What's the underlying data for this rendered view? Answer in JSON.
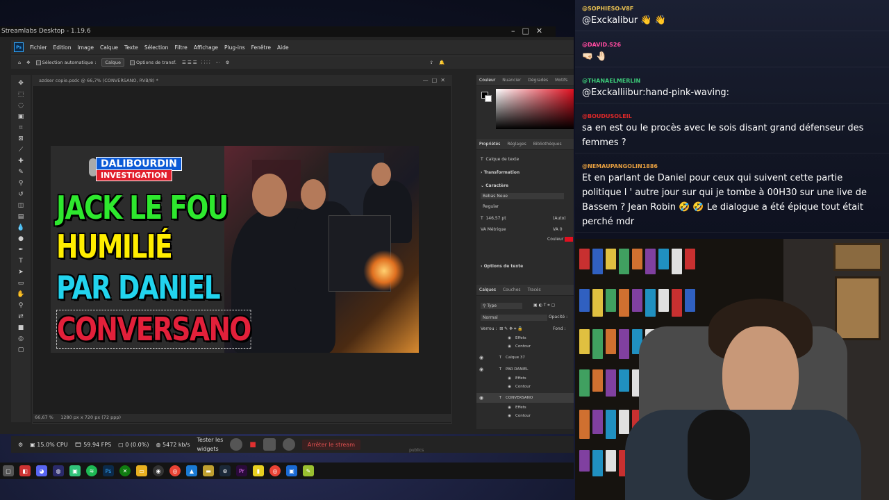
{
  "streamlabs": {
    "title": "Streamlabs Desktop - 1.19.6"
  },
  "photoshop": {
    "logo": "Ps",
    "menu": [
      "Fichier",
      "Edition",
      "Image",
      "Calque",
      "Texte",
      "Sélection",
      "Filtre",
      "Affichage",
      "Plug-ins",
      "Fenêtre",
      "Aide"
    ],
    "options": {
      "auto_select": "Sélection automatique :",
      "layer_dropdown": "Calque",
      "transform": "Options de transf."
    },
    "doc_tab": "azdser copie.psdc @ 66,7% (CONVERSANO, RVB/8) *",
    "status": {
      "zoom": "66,67 %",
      "dims": "1280 px x 720 px (72 ppp)"
    },
    "panel_tabs_top": [
      "Couleur",
      "Nuancier",
      "Dégradés",
      "Motifs"
    ],
    "panel_tabs_props": [
      "Propriétés",
      "Réglages",
      "Bibliothèques"
    ],
    "props": {
      "layer_kind": "Calque de texte",
      "transformation": "Transformation",
      "caractere": "Caractère",
      "font": "Bebas Neue",
      "style": "Regular",
      "size": "146,57 pt",
      "auto": "(Auto)",
      "kerning": "Métrique",
      "tracking": "0",
      "color_label": "Couleur",
      "text_options": "Options de texte"
    },
    "layers": {
      "tabs": [
        "Calques",
        "Couches",
        "Tracés"
      ],
      "type_filter": "Type",
      "blend": "Normal",
      "opacity_label": "Opacité :",
      "lock_label": "Verrou :",
      "fill_label": "Fond :",
      "rows": [
        {
          "name": "Effets",
          "indent": true
        },
        {
          "name": "Contour",
          "indent": true
        },
        {
          "name": "Calque 37",
          "indent": false
        },
        {
          "name": "PAR DANIEL",
          "indent": false
        },
        {
          "name": "Effets",
          "indent": true
        },
        {
          "name": "Contour",
          "indent": true
        },
        {
          "name": "CONVERSANO",
          "indent": false
        },
        {
          "name": "Effets",
          "indent": true
        },
        {
          "name": "Contour",
          "indent": true
        }
      ]
    },
    "thumbnail": {
      "logo_top": "DALIBOURDIN",
      "logo_bottom": "INVESTIGATION",
      "line1": "JACK LE FOU",
      "line2": "HUMILIÉ",
      "line3": "PAR DANIEL",
      "line4": "CONVERSANO",
      "colors": {
        "line1": "#2ee82e",
        "line2": "#ffee00",
        "line3": "#22d4ee",
        "line4": "#e2203a"
      }
    }
  },
  "obs": {
    "cpu": "15.0% CPU",
    "fps": "59.94 FPS",
    "dropped": "0 (0.0%)",
    "bitrate": "5472 kb/s",
    "test_widgets_1": "Tester les",
    "test_widgets_2": "widgets",
    "stop_stream": "Arrêter le stream",
    "extra": "publics"
  },
  "chat": {
    "messages": [
      {
        "user": "@SOPHIESO-V8F",
        "user_color": "#e8c050",
        "text": "@Exckalibur 👋 👋"
      },
      {
        "user": "@DAVID.S26",
        "user_color": "#ff4aa0",
        "text": "🤜🏻 🤚🏻"
      },
      {
        "user": "@THANAELMERLIN",
        "user_color": "#3cc878",
        "text": "@Exckalliibur:hand-pink-waving:"
      },
      {
        "user": "@BOUDUSOLEIL",
        "user_color": "#e02828",
        "text": "sa en est ou le procès avec le sois disant grand défenseur des femmes ?"
      },
      {
        "user": "@NEMAUPANGOLIN1886",
        "user_color": "#e8a040",
        "text": "Et en parlant de Daniel pour ceux qui suivent cette partie politique l ' autre jour sur qui je tombe à 00H30 sur une live de Bassem ? Jean Robin 🤣 🤣 Le dialogue a été épique tout était perché mdr"
      }
    ]
  }
}
